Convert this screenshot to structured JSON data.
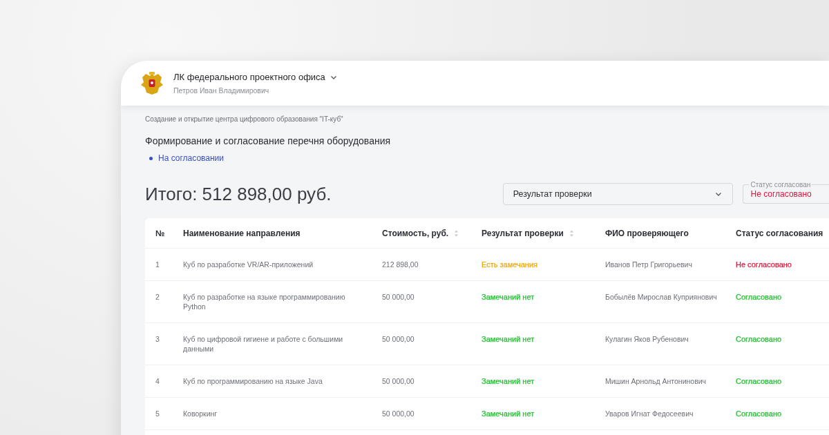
{
  "header": {
    "title": "ЛК федерального проектного офиса",
    "user": "Петров Иван Владимирович"
  },
  "breadcrumb": "Создание и открытие центра цифрового образования \"IT-куб\"",
  "page_title": "Формирование и согласование перечня оборудования",
  "stage": {
    "label": "На согласовании"
  },
  "total": "Итого: 512 898,00 руб.",
  "filters": [
    {
      "kind": "select",
      "placeholder": "Результат проверки"
    },
    {
      "kind": "outlined",
      "label": "Статус согласован",
      "value": "Не согласовано",
      "color": "#e0143c"
    }
  ],
  "table": {
    "columns": [
      {
        "label": "№",
        "sortable": false
      },
      {
        "label": "Наименование направления",
        "sortable": false
      },
      {
        "label": "Стоимость, руб.",
        "sortable": true
      },
      {
        "label": "Результат проверки",
        "sortable": true
      },
      {
        "label": "ФИО проверяющего",
        "sortable": false
      },
      {
        "label": "Статус согласования",
        "sortable": false
      }
    ],
    "rows": [
      {
        "number": "1",
        "name": "Куб по разработке VR/AR-приложений",
        "cost": "212 898,00",
        "result": {
          "text": "Есть замечания",
          "color": "#f0a800"
        },
        "reviewer": "Иванов Петр Григорьевич",
        "status": {
          "text": "Не согласовано",
          "color": "#e0143c"
        }
      },
      {
        "number": "2",
        "name": "Куб по разработке на языке программированию Python",
        "cost": "50 000,00",
        "result": {
          "text": "Замечаний нет",
          "color": "#1fbf2e"
        },
        "reviewer": "Бобылёв Мирослав Куприянович",
        "status": {
          "text": "Согласовано",
          "color": "#1fbf2e"
        }
      },
      {
        "number": "3",
        "name": "Куб по цифровой гигиене и работе с большими данными",
        "cost": "50 000,00",
        "result": {
          "text": "Замечаний нет",
          "color": "#1fbf2e"
        },
        "reviewer": "Кулагин Яков Рубенович",
        "status": {
          "text": "Согласовано",
          "color": "#1fbf2e"
        }
      },
      {
        "number": "4",
        "name": "Куб по программированию на языке Java",
        "cost": "50 000,00",
        "result": {
          "text": "Замечаний нет",
          "color": "#1fbf2e"
        },
        "reviewer": "Мишин Арнольд Антонинович",
        "status": {
          "text": "Согласовано",
          "color": "#1fbf2e"
        }
      },
      {
        "number": "5",
        "name": "Коворкинг",
        "cost": "50 000,00",
        "result": {
          "text": "Замечаний нет",
          "color": "#1fbf2e"
        },
        "reviewer": "Уваров Игнат Федосеевич",
        "status": {
          "text": "Согласовано",
          "color": "#1fbf2e"
        }
      }
    ]
  }
}
